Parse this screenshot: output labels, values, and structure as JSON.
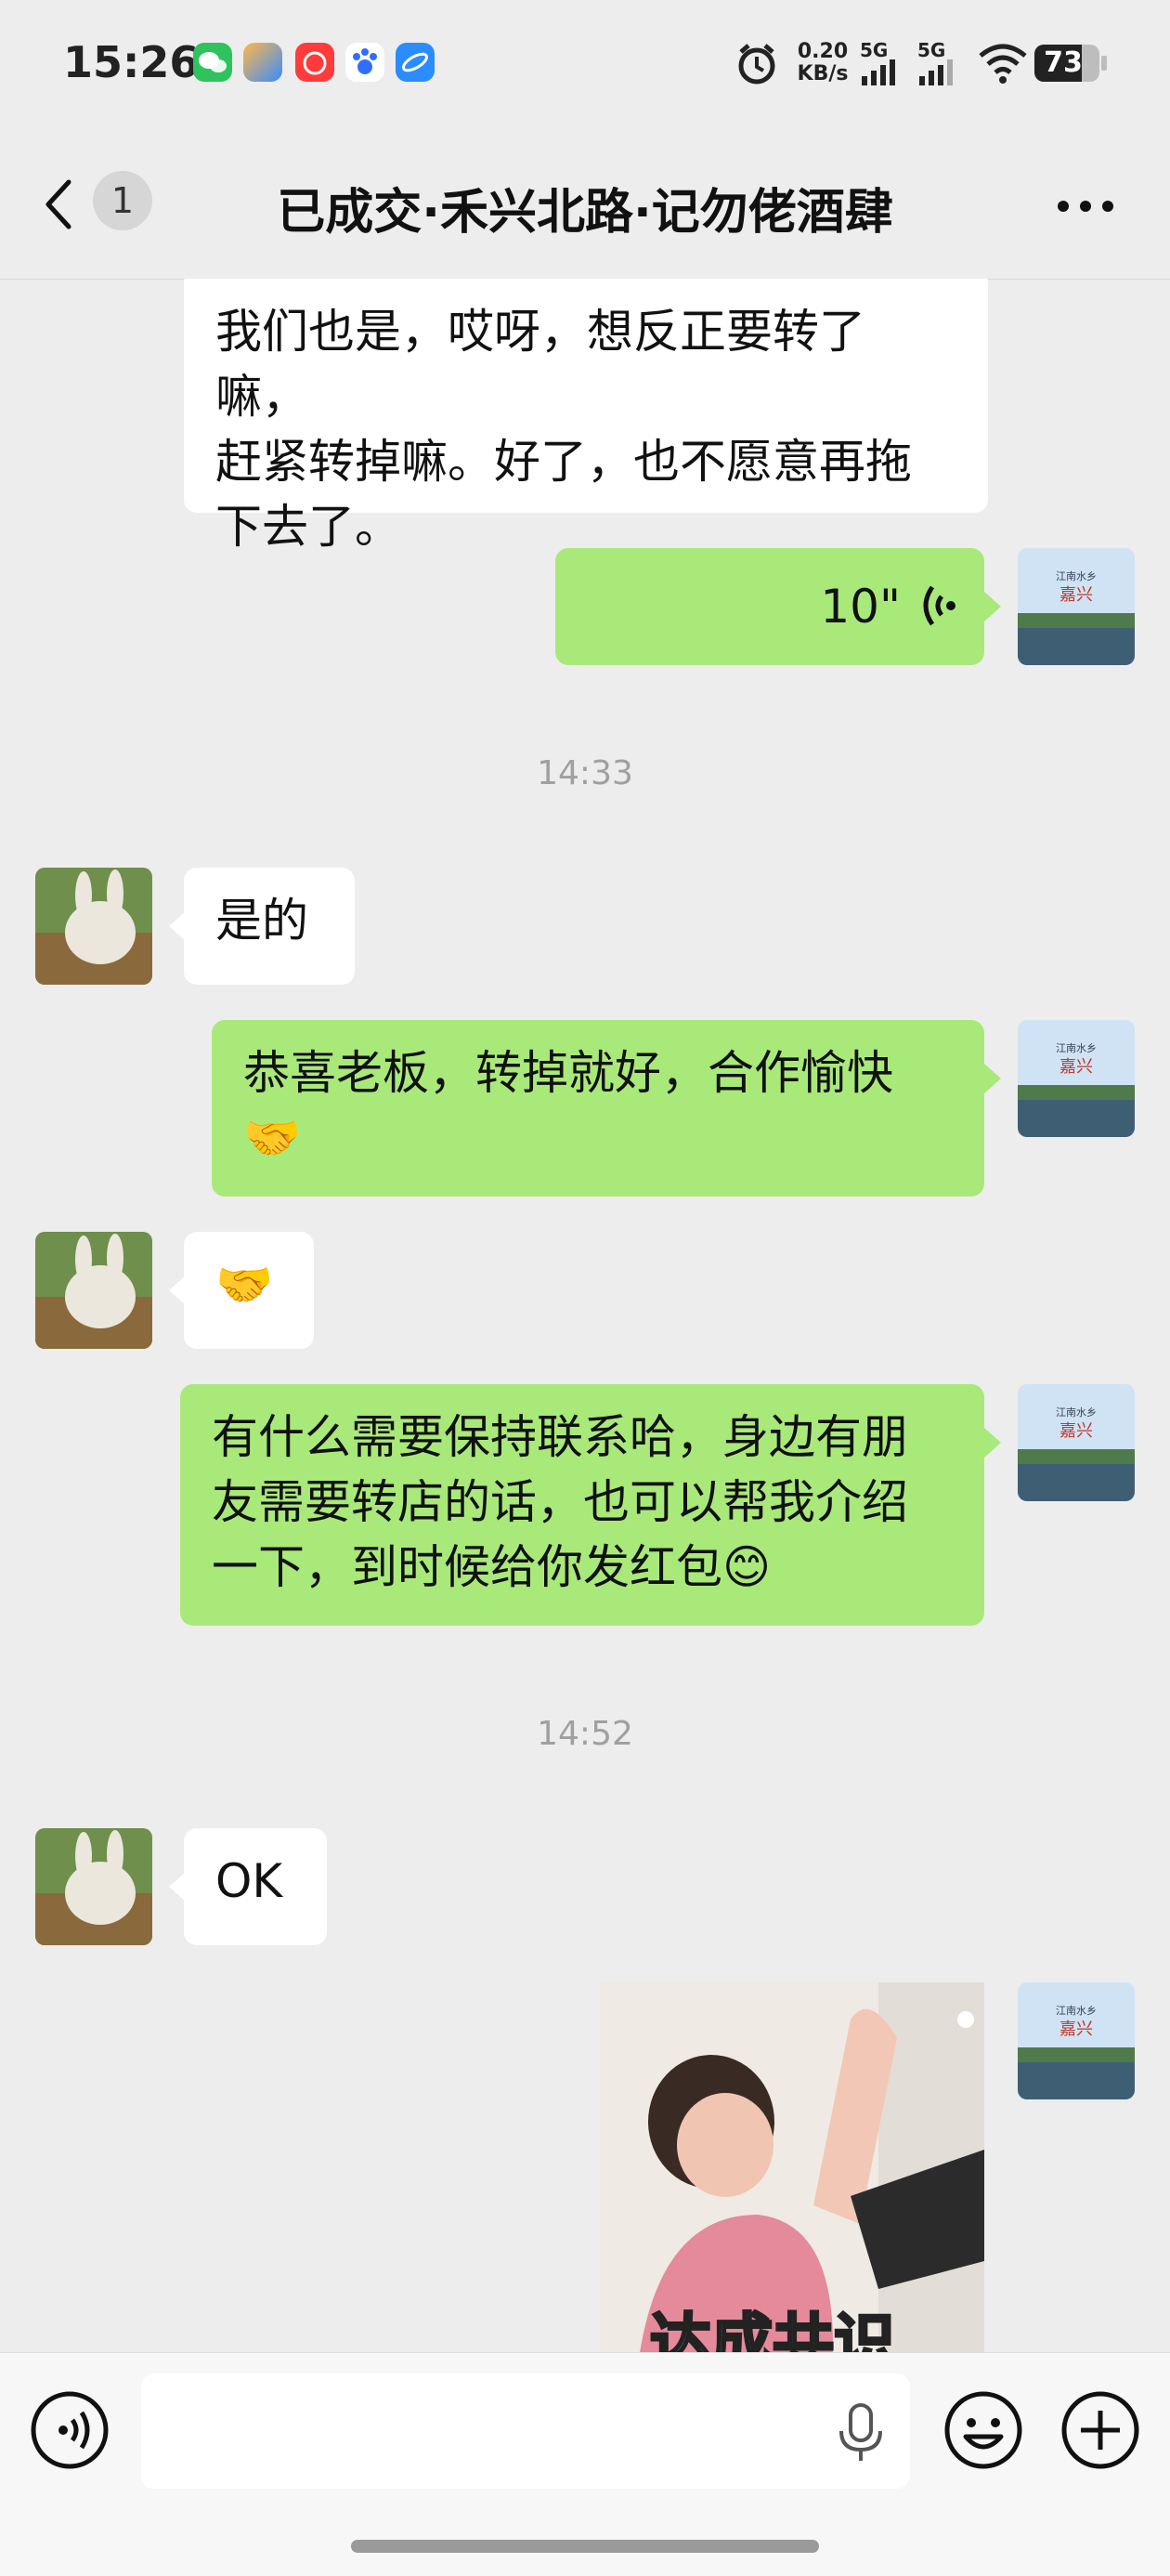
{
  "status_bar": {
    "time": "15:26",
    "net_speed_value": "0.20",
    "net_speed_unit": "KB/s",
    "signal1_label": "5G",
    "signal2_label": "5G",
    "battery": "73",
    "icons": [
      "wechat-icon",
      "app-icon",
      "netease-music-icon",
      "baidu-icon",
      "browser-icon",
      "alarm-icon",
      "wifi-icon",
      "battery-icon"
    ]
  },
  "header": {
    "unread_count": "1",
    "title": "已成交·禾兴北路·记勿佬酒肆"
  },
  "messages": {
    "m1": {
      "lines": [
        "我们也是，哎呀，想反正要转了嘛，",
        "赶紧转掉嘛。好了，也不愿意再拖",
        "下去了。"
      ]
    },
    "m2": {
      "duration": "10\""
    },
    "ts1": "14:33",
    "m3": {
      "text": "是的"
    },
    "m4": {
      "lines": [
        "恭喜老板，转掉就好，合作愉快",
        "🤝"
      ]
    },
    "m5": {
      "text": "🤝"
    },
    "m6": {
      "lines": [
        "有什么需要保持联系哈，身边有朋",
        "友需要转店的话，也可以帮我介绍",
        "一下，到时候给你发红包😊"
      ]
    },
    "ts2": "14:52",
    "m7": {
      "text": "OK"
    },
    "m8": {
      "sticker_caption": "达成共识"
    }
  },
  "avatar_me": {
    "caption_line1": "江南水乡",
    "caption_line2": "嘉兴"
  },
  "colors": {
    "green_bubble": "#a9e97a",
    "background": "#ededed",
    "white_bubble": "#ffffff"
  }
}
